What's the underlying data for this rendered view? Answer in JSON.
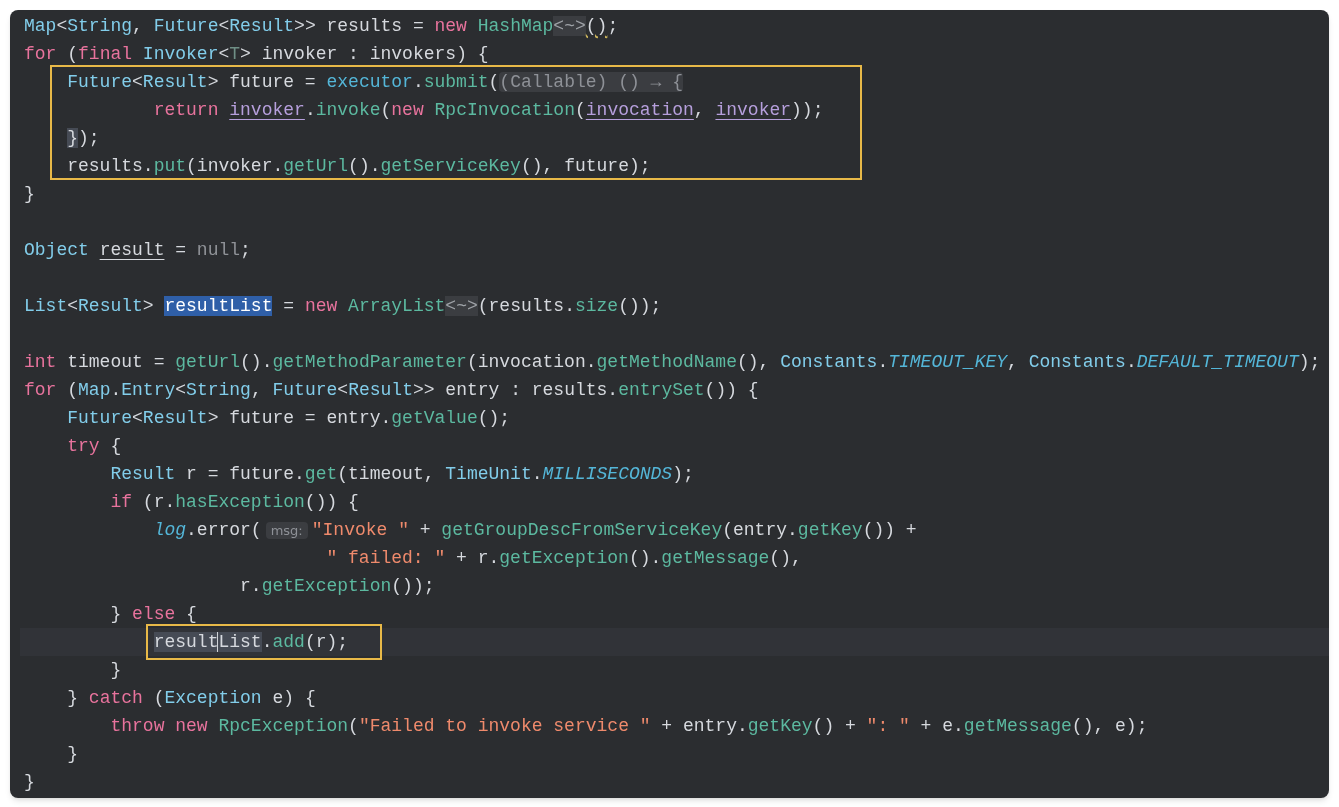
{
  "editor": {
    "lines": [
      {
        "kind": "code",
        "tokens": [
          {
            "text": "Map",
            "kind": "type"
          },
          {
            "text": "<",
            "kind": "plain"
          },
          {
            "text": "String",
            "kind": "type"
          },
          {
            "text": ", ",
            "kind": "plain"
          },
          {
            "text": "Future",
            "kind": "type"
          },
          {
            "text": "<",
            "kind": "plain"
          },
          {
            "text": "Result",
            "kind": "type"
          },
          {
            "text": ">> results = ",
            "kind": "plain"
          },
          {
            "text": "new ",
            "kind": "keyword"
          },
          {
            "text": "HashMap",
            "kind": "method"
          },
          {
            "text": "<~>",
            "kind": "diamond"
          },
          {
            "text": "()",
            "kind": "plain",
            "warning": true
          },
          {
            "text": ";",
            "kind": "plain"
          }
        ]
      },
      {
        "kind": "code",
        "tokens": [
          {
            "text": "for ",
            "kind": "keyword"
          },
          {
            "text": "(",
            "kind": "plain"
          },
          {
            "text": "final ",
            "kind": "keyword"
          },
          {
            "text": "Invoker",
            "kind": "type"
          },
          {
            "text": "<",
            "kind": "plain"
          },
          {
            "text": "T",
            "kind": "generic"
          },
          {
            "text": "> invoker : invokers) {",
            "kind": "plain"
          }
        ]
      },
      {
        "kind": "code",
        "framed": true,
        "tokens": [
          {
            "text": "    Future",
            "kind": "type"
          },
          {
            "text": "<",
            "kind": "plain"
          },
          {
            "text": "Result",
            "kind": "type"
          },
          {
            "text": "> future = ",
            "kind": "plain"
          },
          {
            "text": "executor",
            "kind": "field"
          },
          {
            "text": ".",
            "kind": "plain"
          },
          {
            "text": "submit",
            "kind": "method"
          },
          {
            "text": "(",
            "kind": "plain"
          },
          {
            "text": "(Callable) () → {",
            "kind": "hint"
          }
        ]
      },
      {
        "kind": "code",
        "framed": true,
        "tokens": [
          {
            "text": "            return ",
            "kind": "keyword"
          },
          {
            "text": "invoker",
            "kind": "captured"
          },
          {
            "text": ".",
            "kind": "plain"
          },
          {
            "text": "invoke",
            "kind": "method"
          },
          {
            "text": "(",
            "kind": "plain"
          },
          {
            "text": "new ",
            "kind": "keyword"
          },
          {
            "text": "RpcInvocation",
            "kind": "method"
          },
          {
            "text": "(",
            "kind": "plain"
          },
          {
            "text": "invocation",
            "kind": "captured"
          },
          {
            "text": ", ",
            "kind": "plain"
          },
          {
            "text": "invoker",
            "kind": "captured"
          },
          {
            "text": "));",
            "kind": "plain"
          }
        ]
      },
      {
        "kind": "code",
        "framed": true,
        "tokens": [
          {
            "text": "    }",
            "kind": "plain",
            "occurrence": true
          },
          {
            "text": ");",
            "kind": "plain"
          }
        ]
      },
      {
        "kind": "code",
        "framed": true,
        "tokens": [
          {
            "text": "    results.",
            "kind": "plain"
          },
          {
            "text": "put",
            "kind": "method"
          },
          {
            "text": "(invoker.",
            "kind": "plain"
          },
          {
            "text": "getUrl",
            "kind": "method"
          },
          {
            "text": "().",
            "kind": "plain"
          },
          {
            "text": "getServiceKey",
            "kind": "method"
          },
          {
            "text": "(), future);",
            "kind": "plain"
          }
        ]
      },
      {
        "kind": "code",
        "tokens": [
          {
            "text": "}",
            "kind": "plain"
          }
        ]
      },
      {
        "kind": "blank"
      },
      {
        "kind": "code",
        "tokens": [
          {
            "text": "Object ",
            "kind": "type"
          },
          {
            "text": "result",
            "kind": "reassigned"
          },
          {
            "text": " = ",
            "kind": "plain"
          },
          {
            "text": "null",
            "kind": "null"
          },
          {
            "text": ";",
            "kind": "plain"
          }
        ]
      },
      {
        "kind": "blank"
      },
      {
        "kind": "code",
        "tokens": [
          {
            "text": "List",
            "kind": "type"
          },
          {
            "text": "<",
            "kind": "plain"
          },
          {
            "text": "Result",
            "kind": "type"
          },
          {
            "text": "> ",
            "kind": "plain"
          },
          {
            "text": "resultList",
            "kind": "selected"
          },
          {
            "text": " = ",
            "kind": "plain"
          },
          {
            "text": "new ",
            "kind": "keyword"
          },
          {
            "text": "ArrayList",
            "kind": "method"
          },
          {
            "text": "<~>",
            "kind": "diamond"
          },
          {
            "text": "(results.",
            "kind": "plain"
          },
          {
            "text": "size",
            "kind": "method"
          },
          {
            "text": "());",
            "kind": "plain"
          }
        ]
      },
      {
        "kind": "blank"
      },
      {
        "kind": "code",
        "tokens": [
          {
            "text": "int ",
            "kind": "keyword"
          },
          {
            "text": "timeout = ",
            "kind": "plain"
          },
          {
            "text": "getUrl",
            "kind": "method"
          },
          {
            "text": "().",
            "kind": "plain"
          },
          {
            "text": "getMethodParameter",
            "kind": "method"
          },
          {
            "text": "(invocation.",
            "kind": "plain"
          },
          {
            "text": "getMethodName",
            "kind": "method"
          },
          {
            "text": "(), ",
            "kind": "plain"
          },
          {
            "text": "Constants",
            "kind": "type"
          },
          {
            "text": ".",
            "kind": "plain"
          },
          {
            "text": "TIMEOUT_KEY",
            "kind": "constant"
          },
          {
            "text": ", ",
            "kind": "plain"
          },
          {
            "text": "Constants",
            "kind": "type"
          },
          {
            "text": ".",
            "kind": "plain"
          },
          {
            "text": "DEFAULT_TIMEOUT",
            "kind": "constant"
          },
          {
            "text": ");",
            "kind": "plain"
          }
        ]
      },
      {
        "kind": "code",
        "tokens": [
          {
            "text": "for ",
            "kind": "keyword"
          },
          {
            "text": "(",
            "kind": "plain"
          },
          {
            "text": "Map",
            "kind": "type"
          },
          {
            "text": ".",
            "kind": "plain"
          },
          {
            "text": "Entry",
            "kind": "type"
          },
          {
            "text": "<",
            "kind": "plain"
          },
          {
            "text": "String",
            "kind": "type"
          },
          {
            "text": ", ",
            "kind": "plain"
          },
          {
            "text": "Future",
            "kind": "type"
          },
          {
            "text": "<",
            "kind": "plain"
          },
          {
            "text": "Result",
            "kind": "type"
          },
          {
            "text": ">> entry : results.",
            "kind": "plain"
          },
          {
            "text": "entrySet",
            "kind": "method"
          },
          {
            "text": "()) {",
            "kind": "plain"
          }
        ]
      },
      {
        "kind": "code",
        "tokens": [
          {
            "text": "    Future",
            "kind": "type"
          },
          {
            "text": "<",
            "kind": "plain"
          },
          {
            "text": "Result",
            "kind": "type"
          },
          {
            "text": "> future = entry.",
            "kind": "plain"
          },
          {
            "text": "getValue",
            "kind": "method"
          },
          {
            "text": "();",
            "kind": "plain"
          }
        ]
      },
      {
        "kind": "code",
        "tokens": [
          {
            "text": "    try ",
            "kind": "keyword"
          },
          {
            "text": "{",
            "kind": "plain"
          }
        ]
      },
      {
        "kind": "code",
        "tokens": [
          {
            "text": "        Result",
            "kind": "type"
          },
          {
            "text": " r = future.",
            "kind": "plain"
          },
          {
            "text": "get",
            "kind": "method"
          },
          {
            "text": "(timeout, ",
            "kind": "plain"
          },
          {
            "text": "TimeUnit",
            "kind": "type"
          },
          {
            "text": ".",
            "kind": "plain"
          },
          {
            "text": "MILLISECONDS",
            "kind": "constant"
          },
          {
            "text": ");",
            "kind": "plain"
          }
        ]
      },
      {
        "kind": "code",
        "tokens": [
          {
            "text": "        if ",
            "kind": "keyword"
          },
          {
            "text": "(r.",
            "kind": "plain"
          },
          {
            "text": "hasException",
            "kind": "method"
          },
          {
            "text": "()) {",
            "kind": "plain"
          }
        ]
      },
      {
        "kind": "code",
        "tokens": [
          {
            "text": "            log",
            "kind": "constant"
          },
          {
            "text": ".error(",
            "kind": "plain"
          },
          {
            "text": "msg:",
            "kind": "param-hint"
          },
          {
            "text": "\"Invoke \"",
            "kind": "string"
          },
          {
            "text": " + ",
            "kind": "plain"
          },
          {
            "text": "getGroupDescFromServiceKey",
            "kind": "method"
          },
          {
            "text": "(entry.",
            "kind": "plain"
          },
          {
            "text": "getKey",
            "kind": "method"
          },
          {
            "text": "()) +",
            "kind": "plain"
          }
        ]
      },
      {
        "kind": "code",
        "tokens": [
          {
            "text": "                            \" failed: \"",
            "kind": "string"
          },
          {
            "text": " + r.",
            "kind": "plain"
          },
          {
            "text": "getException",
            "kind": "method"
          },
          {
            "text": "().",
            "kind": "plain"
          },
          {
            "text": "getMessage",
            "kind": "method"
          },
          {
            "text": "(),",
            "kind": "plain"
          }
        ]
      },
      {
        "kind": "code",
        "tokens": [
          {
            "text": "                    r.",
            "kind": "plain"
          },
          {
            "text": "getException",
            "kind": "method"
          },
          {
            "text": "());",
            "kind": "plain"
          }
        ]
      },
      {
        "kind": "code",
        "tokens": [
          {
            "text": "        } ",
            "kind": "plain"
          },
          {
            "text": "else ",
            "kind": "keyword"
          },
          {
            "text": "{",
            "kind": "plain"
          }
        ]
      },
      {
        "kind": "code",
        "current": true,
        "boxed": true,
        "tokens": [
          {
            "text": "            result",
            "kind": "plain",
            "occurrence": true,
            "caret_after": true
          },
          {
            "text": "List",
            "kind": "plain",
            "occurrence": true
          },
          {
            "text": ".",
            "kind": "plain"
          },
          {
            "text": "add",
            "kind": "method"
          },
          {
            "text": "(r);",
            "kind": "plain"
          }
        ]
      },
      {
        "kind": "code",
        "tokens": [
          {
            "text": "        }",
            "kind": "plain"
          }
        ]
      },
      {
        "kind": "code",
        "tokens": [
          {
            "text": "    } ",
            "kind": "plain"
          },
          {
            "text": "catch ",
            "kind": "keyword"
          },
          {
            "text": "(",
            "kind": "plain"
          },
          {
            "text": "Exception",
            "kind": "type"
          },
          {
            "text": " e) {",
            "kind": "plain"
          }
        ]
      },
      {
        "kind": "code",
        "tokens": [
          {
            "text": "        throw ",
            "kind": "keyword"
          },
          {
            "text": "new ",
            "kind": "keyword"
          },
          {
            "text": "RpcException",
            "kind": "method"
          },
          {
            "text": "(",
            "kind": "plain"
          },
          {
            "text": "\"Failed to invoke service \"",
            "kind": "string"
          },
          {
            "text": " + entry.",
            "kind": "plain"
          },
          {
            "text": "getKey",
            "kind": "method"
          },
          {
            "text": "() + ",
            "kind": "plain"
          },
          {
            "text": "\": \"",
            "kind": "string"
          },
          {
            "text": " + e.",
            "kind": "plain"
          },
          {
            "text": "getMessage",
            "kind": "method"
          },
          {
            "text": "(), e);",
            "kind": "plain"
          }
        ]
      },
      {
        "kind": "code",
        "tokens": [
          {
            "text": "    }",
            "kind": "plain"
          }
        ]
      },
      {
        "kind": "code",
        "tokens": [
          {
            "text": "}",
            "kind": "plain"
          }
        ]
      }
    ]
  }
}
